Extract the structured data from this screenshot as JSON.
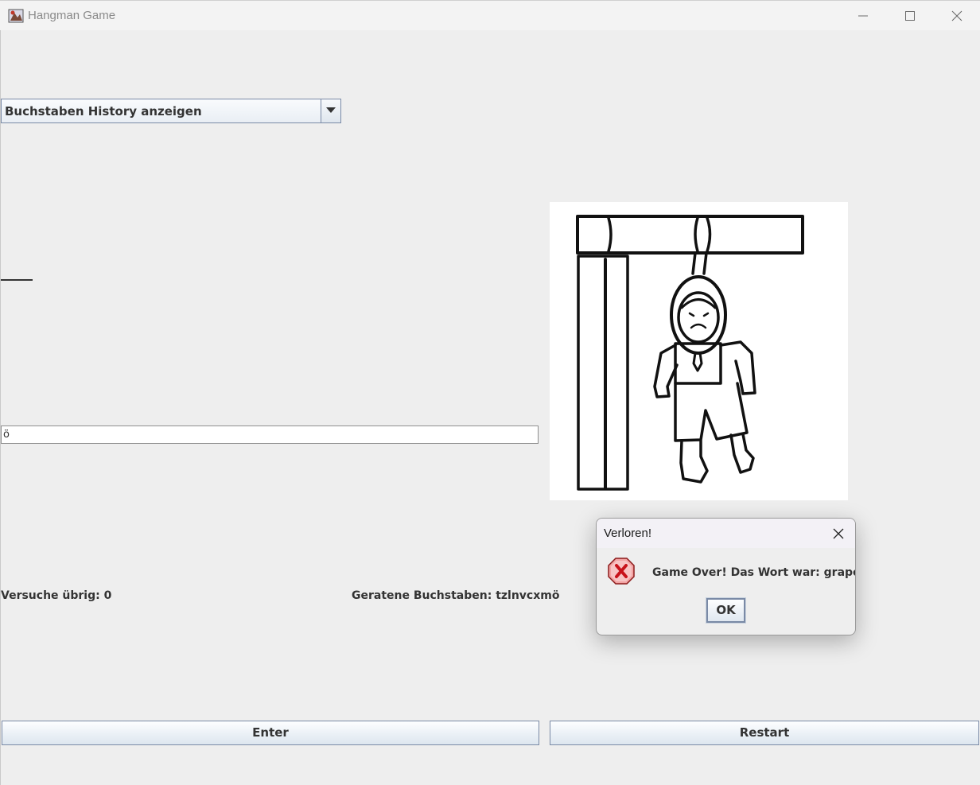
{
  "window": {
    "title": "Hangman Game"
  },
  "history_dropdown": {
    "selected": "Buchstaben History anzeigen"
  },
  "input": {
    "value": "ö"
  },
  "status": {
    "attempts": "Versuche übrig: 0",
    "guessed": "Geratene Buchstaben: tzlnvcxmö"
  },
  "buttons": {
    "enter": "Enter",
    "restart": "Restart"
  },
  "dialog": {
    "title": "Verloren!",
    "message": "Game Over! Das Wort war: grape",
    "ok": "OK",
    "icon": "error-icon"
  },
  "colors": {
    "error_red": "#c8121a",
    "button_border": "#7a8aa6"
  }
}
